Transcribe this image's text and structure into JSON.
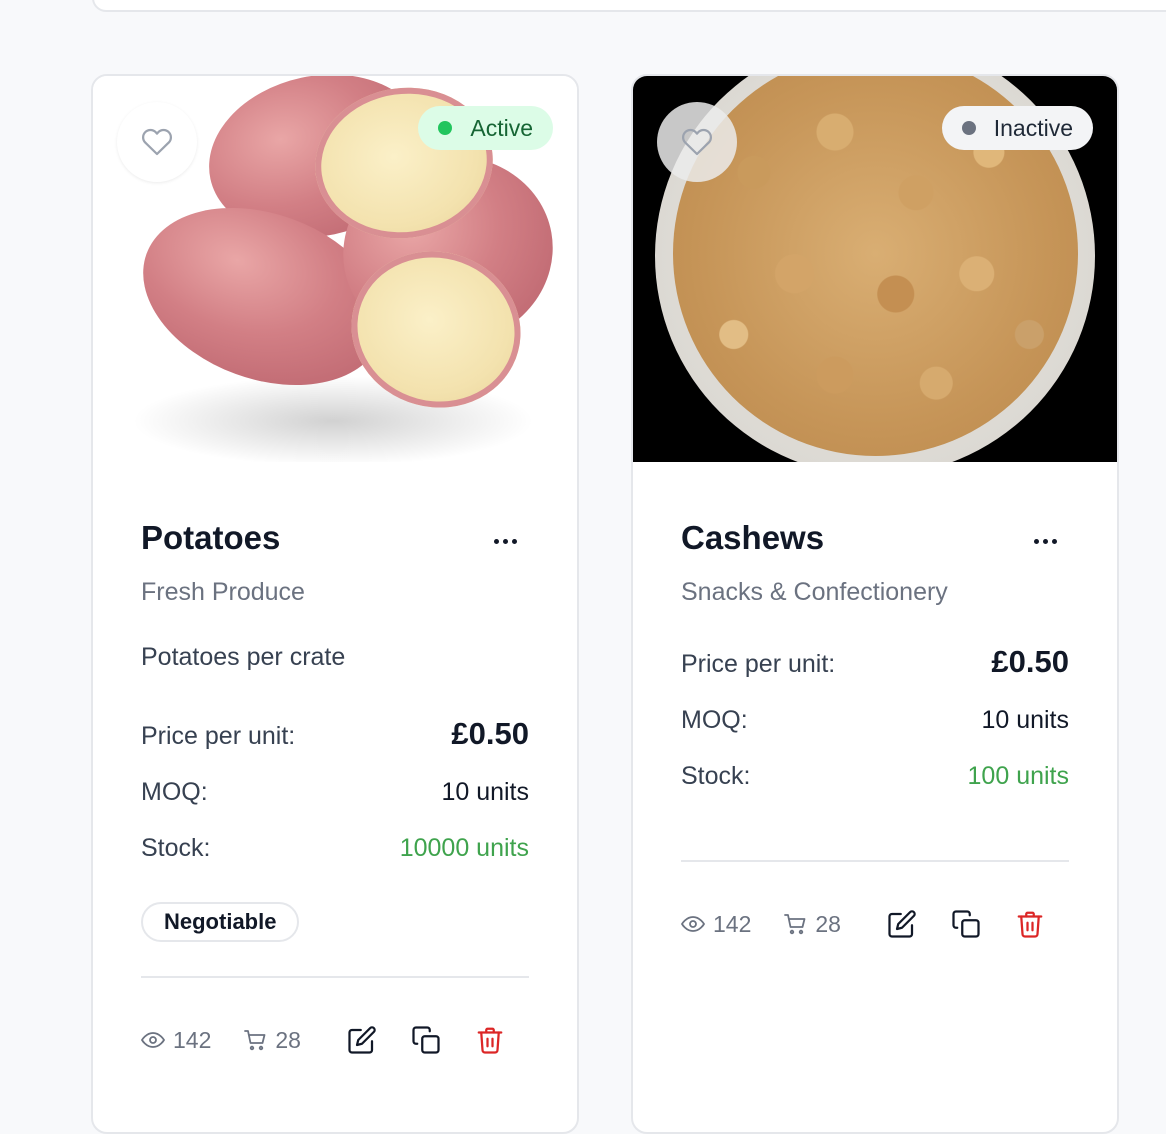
{
  "products": [
    {
      "name": "Potatoes",
      "category": "Fresh Produce",
      "description": "Potatoes per crate",
      "status": "Active",
      "price_label": "Price per unit:",
      "price": "£0.50",
      "moq_label": "MOQ:",
      "moq": "10 units",
      "stock_label": "Stock:",
      "stock": "10000 units",
      "tag": "Negotiable",
      "views": "142",
      "carts": "28",
      "image": "potatoes"
    },
    {
      "name": "Cashews",
      "category": "Snacks & Confectionery",
      "status": "Inactive",
      "price_label": "Price per unit:",
      "price": "£0.50",
      "moq_label": "MOQ:",
      "moq": "10 units",
      "stock_label": "Stock:",
      "stock": "100 units",
      "views": "142",
      "carts": "28",
      "image": "cashews"
    }
  ],
  "icons": {
    "favorite": "heart-icon",
    "menu": "more-horizontal-icon",
    "views": "eye-icon",
    "carts": "cart-icon",
    "edit": "edit-icon",
    "duplicate": "copy-icon",
    "delete": "trash-icon"
  },
  "colors": {
    "active_badge_bg": "#dcfce7",
    "active_dot": "#22c55e",
    "inactive_badge_bg": "#f3f4f6",
    "inactive_dot": "#6b7280",
    "stock_text": "#3fa34d",
    "delete_icon": "#dc2626"
  }
}
